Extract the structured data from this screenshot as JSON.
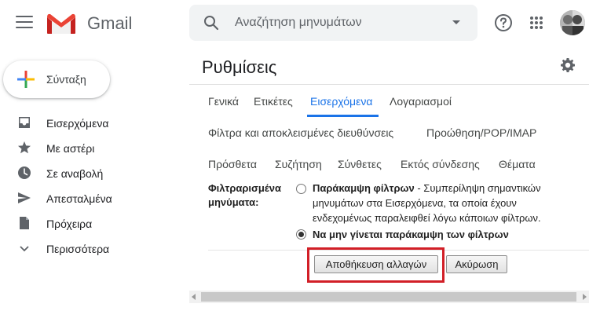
{
  "header": {
    "brand": "Gmail",
    "search_placeholder": "Αναζήτηση μηνυμάτων",
    "icons": {
      "menu": "hamburger-icon",
      "search": "search-icon",
      "help": "help-icon",
      "apps": "apps-grid-icon",
      "logo": "gmail-logo"
    }
  },
  "sidebar": {
    "compose_label": "Σύνταξη",
    "items": [
      {
        "label": "Εισερχόμενα",
        "icon": "inbox-icon"
      },
      {
        "label": "Με αστέρι",
        "icon": "star-icon"
      },
      {
        "label": "Σε αναβολή",
        "icon": "clock-icon"
      },
      {
        "label": "Απεσταλμένα",
        "icon": "send-icon"
      },
      {
        "label": "Πρόχειρα",
        "icon": "draft-icon"
      },
      {
        "label": "Περισσότερα",
        "icon": "chevron-down-icon"
      }
    ]
  },
  "settings": {
    "title": "Ρυθμίσεις",
    "tabs": [
      {
        "label": "Γενικά",
        "active": false
      },
      {
        "label": "Ετικέτες",
        "active": false
      },
      {
        "label": "Εισερχόμενα",
        "active": true
      },
      {
        "label": "Λογαριασμοί",
        "active": false
      },
      {
        "label": "Φίλτρα και αποκλεισμένες διευθύνσεις",
        "active": false
      },
      {
        "label": "Προώθηση/POP/IMAP",
        "active": false
      },
      {
        "label": "Πρόσθετα",
        "active": false
      },
      {
        "label": "Συζήτηση",
        "active": false
      },
      {
        "label": "Σύνθετες",
        "active": false
      },
      {
        "label": "Εκτός σύνδεσης",
        "active": false
      },
      {
        "label": "Θέματα",
        "active": false
      }
    ],
    "filtered": {
      "label_line1": "Φιλτραρισμένα",
      "label_line2": "μηνύματα:",
      "option1_title": "Παράκαμψη φίλτρων",
      "option1_line1": " - Συμπερίληψη σημαντικών",
      "option1_line2": "μηνυμάτων στα Εισερχόμενα, τα οποία έχουν",
      "option1_line3": "ενδεχομένως παραλειφθεί λόγω κάποιων φίλτρων.",
      "option2_title": "Να μην γίνεται παράκαμψη των φίλτρων",
      "selected": 2
    },
    "save_label": "Αποθήκευση αλλαγών",
    "cancel_label": "Ακύρωση"
  },
  "colors": {
    "accent": "#1a73e8",
    "highlight": "#d21f27"
  }
}
